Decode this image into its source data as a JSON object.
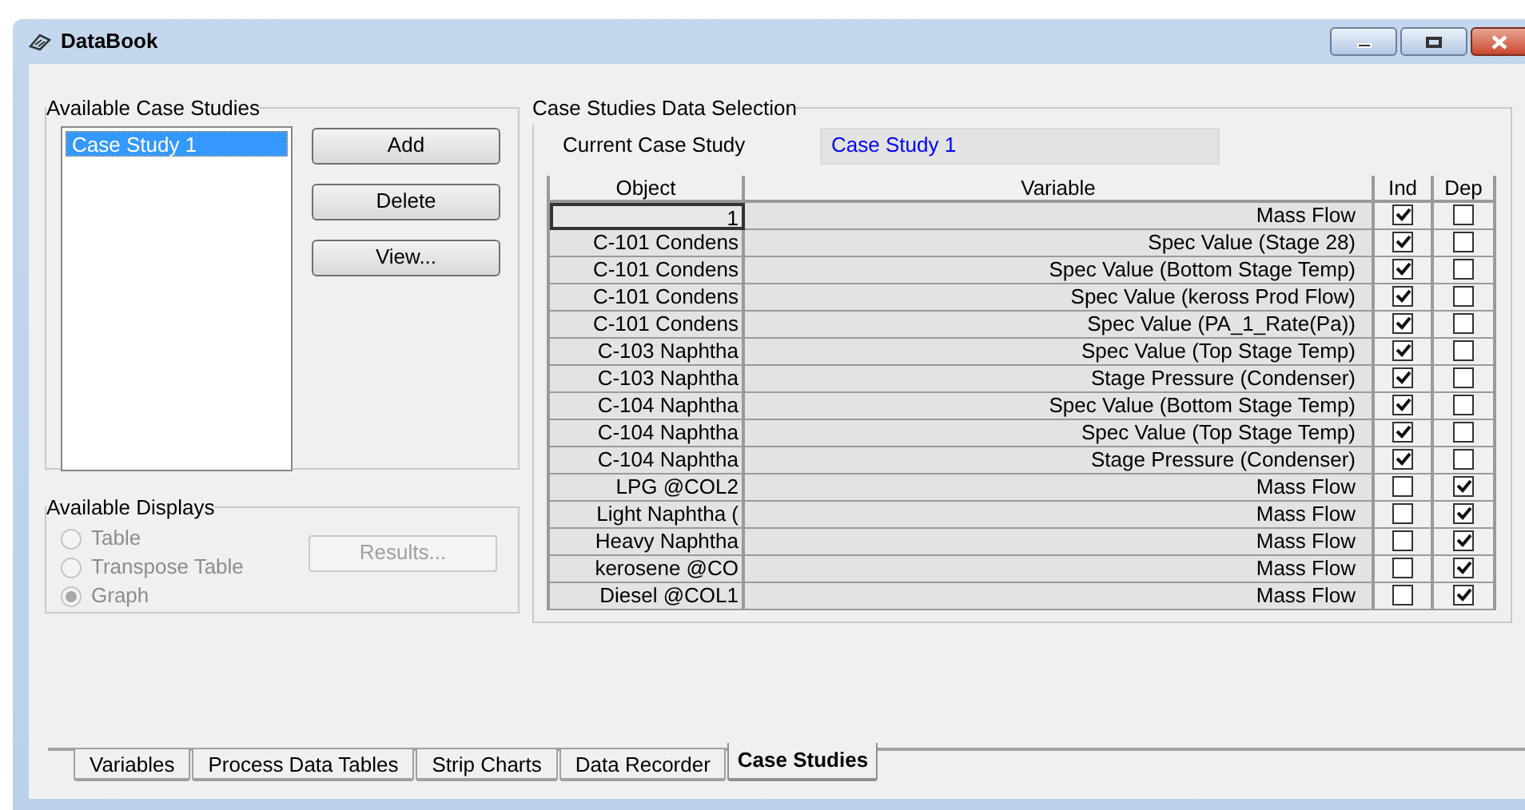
{
  "window": {
    "title": "DataBook"
  },
  "case_studies": {
    "title": "Available Case Studies",
    "items": [
      {
        "label": "Case Study 1",
        "selected": true
      }
    ],
    "buttons": [
      {
        "label": "Add",
        "disabled": false
      },
      {
        "label": "Delete",
        "disabled": false
      },
      {
        "label": "View...",
        "disabled": false
      }
    ]
  },
  "displays": {
    "title": "Available Displays",
    "options": [
      {
        "label": "Table",
        "selected": false,
        "disabled": true
      },
      {
        "label": "Transpose Table",
        "selected": false,
        "disabled": true
      },
      {
        "label": "Graph",
        "selected": true,
        "disabled": true
      }
    ],
    "button": {
      "label": "Results...",
      "disabled": true
    }
  },
  "selection": {
    "title": "Case Studies Data Selection",
    "current_label": "Current Case Study",
    "current_value": "Case Study 1",
    "table": {
      "columns": [
        "Object",
        "Variable",
        "Ind",
        "Dep"
      ],
      "rows": [
        {
          "object": "1",
          "variable": "Mass Flow",
          "ind": true,
          "dep": false,
          "selected": true
        },
        {
          "object": "C-101 Condens",
          "variable": "Spec Value (Stage 28)",
          "ind": true,
          "dep": false,
          "selected": false
        },
        {
          "object": "C-101 Condens",
          "variable": "Spec Value (Bottom Stage Temp)",
          "ind": true,
          "dep": false,
          "selected": false
        },
        {
          "object": "C-101 Condens",
          "variable": "Spec Value (keross Prod Flow)",
          "ind": true,
          "dep": false,
          "selected": false
        },
        {
          "object": "C-101 Condens",
          "variable": "Spec Value (PA_1_Rate(Pa))",
          "ind": true,
          "dep": false,
          "selected": false
        },
        {
          "object": "C-103 Naphtha",
          "variable": "Spec Value (Top Stage Temp)",
          "ind": true,
          "dep": false,
          "selected": false
        },
        {
          "object": "C-103 Naphtha",
          "variable": "Stage Pressure (Condenser)",
          "ind": true,
          "dep": false,
          "selected": false
        },
        {
          "object": "C-104 Naphtha",
          "variable": "Spec Value (Bottom Stage Temp)",
          "ind": true,
          "dep": false,
          "selected": false
        },
        {
          "object": "C-104 Naphtha",
          "variable": "Spec Value (Top Stage Temp)",
          "ind": true,
          "dep": false,
          "selected": false
        },
        {
          "object": "C-104 Naphtha",
          "variable": "Stage Pressure (Condenser)",
          "ind": true,
          "dep": false,
          "selected": false
        },
        {
          "object": "LPG @COL2",
          "variable": "Mass Flow",
          "ind": false,
          "dep": true,
          "selected": false
        },
        {
          "object": "Light Naphtha (",
          "variable": "Mass Flow",
          "ind": false,
          "dep": true,
          "selected": false
        },
        {
          "object": "Heavy Naphtha",
          "variable": "Mass Flow",
          "ind": false,
          "dep": true,
          "selected": false
        },
        {
          "object": "kerosene @CO",
          "variable": "Mass Flow",
          "ind": false,
          "dep": true,
          "selected": false
        },
        {
          "object": "Diesel @COL1",
          "variable": "Mass Flow",
          "ind": false,
          "dep": true,
          "selected": false
        }
      ]
    }
  },
  "tabs": [
    {
      "label": "Variables",
      "selected": false
    },
    {
      "label": "Process Data Tables",
      "selected": false
    },
    {
      "label": "Strip Charts",
      "selected": false
    },
    {
      "label": "Data Recorder",
      "selected": false
    },
    {
      "label": "Case Studies",
      "selected": true
    }
  ]
}
